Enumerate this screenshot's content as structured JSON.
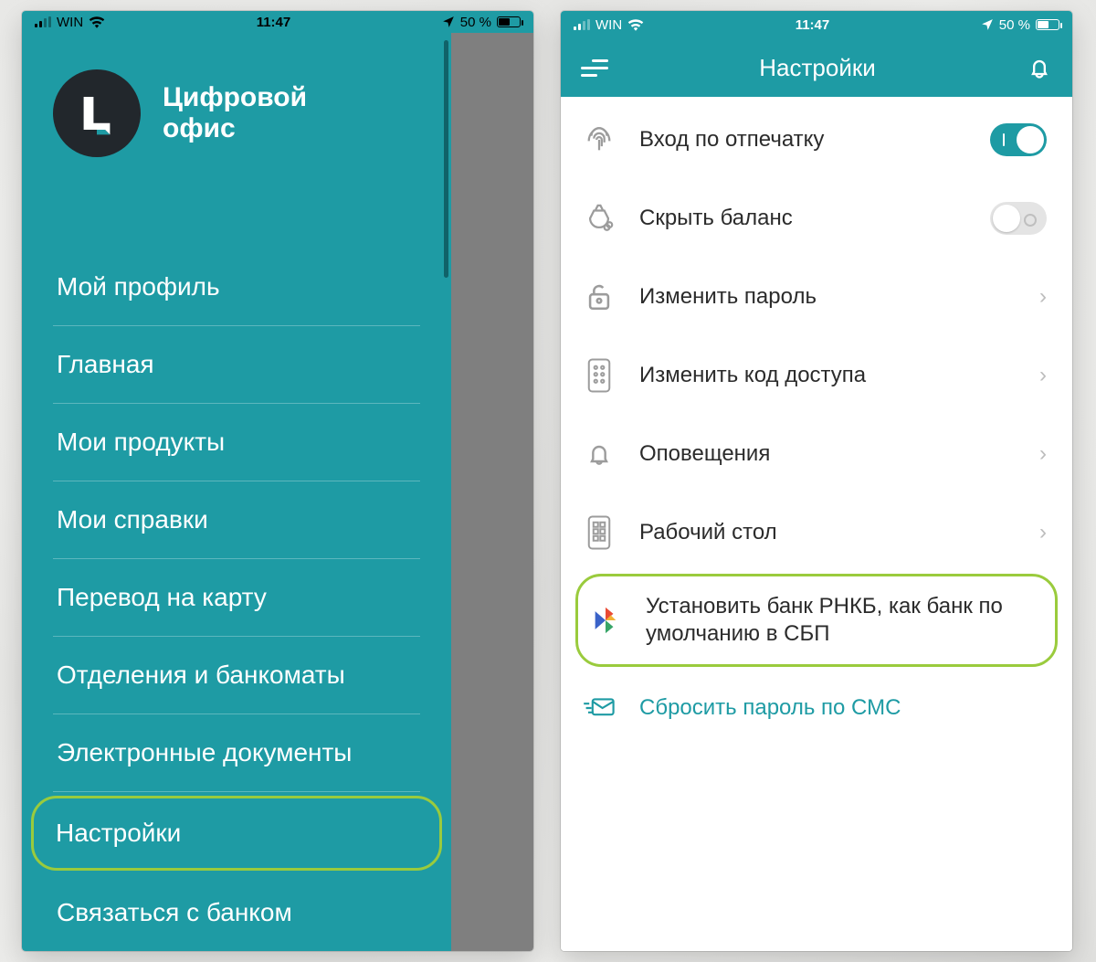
{
  "status": {
    "carrier": "WIN",
    "time": "11:47",
    "battery_text": "50 %"
  },
  "left": {
    "brand_line1": "Цифровой",
    "brand_line2": "офис",
    "menu": [
      "Мой профиль",
      "Главная",
      "Мои продукты",
      "Мои справки",
      "Перевод на карту",
      "Отделения и банкоматы",
      "Электронные документы",
      "Настройки",
      "Связаться с банком"
    ],
    "highlight_index": 7
  },
  "right": {
    "title": "Настройки",
    "rows": [
      {
        "icon": "fingerprint",
        "label": "Вход по отпечатку",
        "type": "toggle",
        "value": true
      },
      {
        "icon": "moneybag",
        "label": "Скрыть баланс",
        "type": "toggle",
        "value": false
      },
      {
        "icon": "lock-open",
        "label": "Изменить пароль",
        "type": "nav"
      },
      {
        "icon": "keypad",
        "label": "Изменить код доступа",
        "type": "nav"
      },
      {
        "icon": "bell",
        "label": "Оповещения",
        "type": "nav"
      },
      {
        "icon": "dashboard",
        "label": "Рабочий стол",
        "type": "nav"
      },
      {
        "icon": "sbp",
        "label": "Установить банк РНКБ, как банк по умолчанию в СБП",
        "type": "highlight"
      },
      {
        "icon": "sms",
        "label": "Сбросить пароль по СМС",
        "type": "link"
      }
    ]
  },
  "colors": {
    "teal": "#1E9BA4",
    "highlight": "#9ACB3D"
  }
}
